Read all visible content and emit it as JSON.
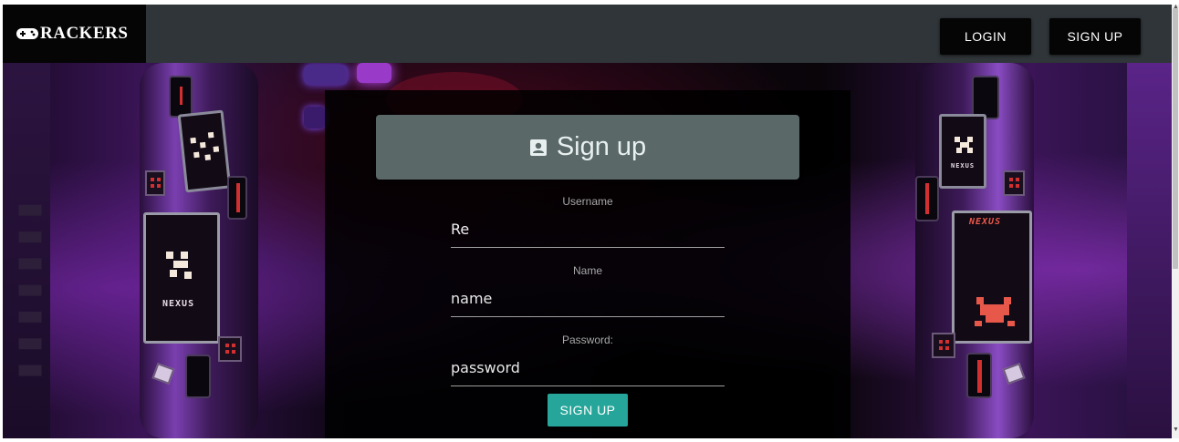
{
  "navbar": {
    "brand": "RACKERS",
    "brand_icon": "gamepad-icon",
    "login_label": "LOGIN",
    "signup_label": "SIGN UP"
  },
  "background": {
    "card_label_1": "NEXUS",
    "card_label_2": "NEXUS",
    "card_label_3": "NEXUS"
  },
  "form": {
    "title": "Sign up",
    "title_icon": "contact-card-icon",
    "username_label": "Username",
    "username_value": "Re",
    "name_label": "Name",
    "name_placeholder": "name",
    "password_label": "Password:",
    "password_placeholder": "password",
    "submit_label": "SIGN UP"
  },
  "colors": {
    "navbar_bg": "#2f3538",
    "header_bg": "#5a6868",
    "submit_bg": "#26a69a"
  }
}
